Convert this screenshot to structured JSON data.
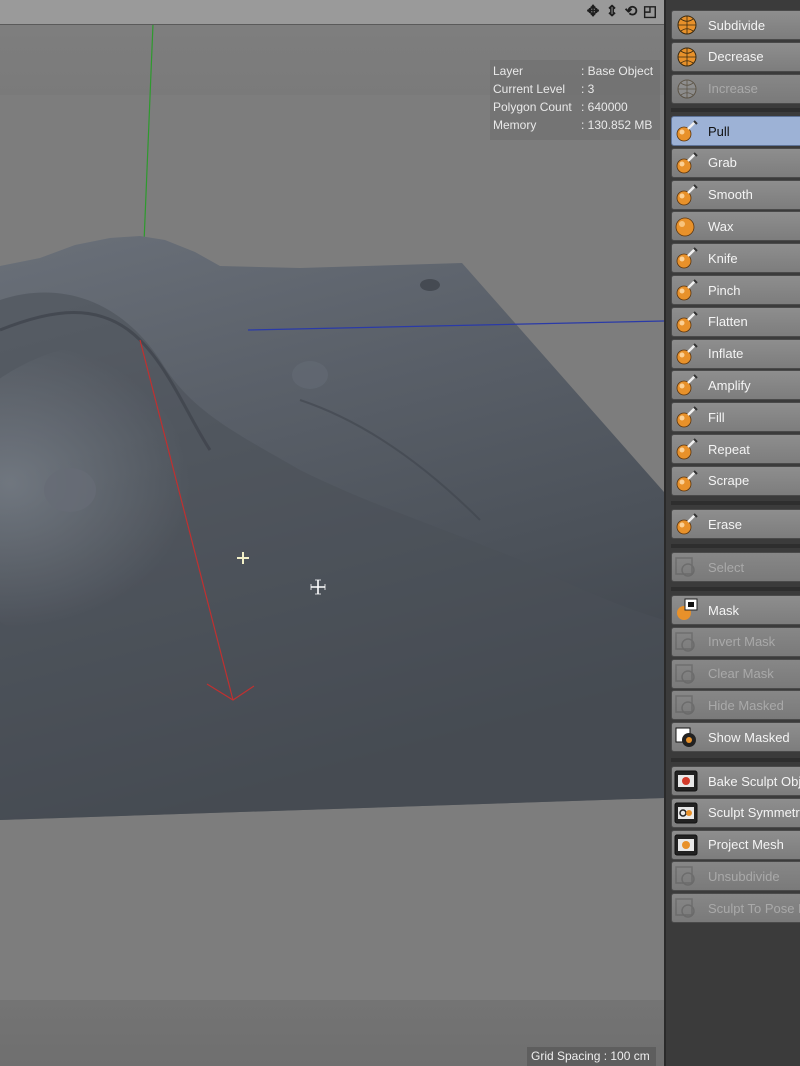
{
  "viewport": {
    "nav_icons": [
      "move-view-icon",
      "dolly-view-icon",
      "rotate-view-icon",
      "maximize-view-icon"
    ],
    "nav_glyphs": [
      "✥",
      "⇕",
      "⟲",
      "◰"
    ],
    "hud": [
      {
        "key": "Layer",
        "value": ": Base Object"
      },
      {
        "key": "Current Level",
        "value": ": 3"
      },
      {
        "key": "Polygon Count",
        "value": ": 640000"
      },
      {
        "key": "Memory",
        "value": ": 130.852 MB"
      }
    ],
    "grid_spacing": "Grid Spacing : 100 cm",
    "colors": {
      "x_axis": "#c03030",
      "y_axis": "#2e9a2e",
      "z_axis": "#2a3aa8",
      "mesh": "#4f555e"
    }
  },
  "palette": {
    "groups": [
      [
        {
          "label": "Subdivide",
          "icon": "subdivide-globe-icon",
          "state": "normal"
        },
        {
          "label": "Decrease",
          "icon": "decrease-globe-icon",
          "state": "normal"
        },
        {
          "label": "Increase",
          "icon": "increase-globe-icon",
          "state": "disabled"
        }
      ],
      [
        {
          "label": "Pull",
          "icon": "pull-brush-icon",
          "state": "active"
        },
        {
          "label": "Grab",
          "icon": "grab-brush-icon",
          "state": "normal"
        },
        {
          "label": "Smooth",
          "icon": "smooth-brush-icon",
          "state": "normal"
        },
        {
          "label": "Wax",
          "icon": "wax-brush-icon",
          "state": "normal"
        },
        {
          "label": "Knife",
          "icon": "knife-brush-icon",
          "state": "normal"
        },
        {
          "label": "Pinch",
          "icon": "pinch-brush-icon",
          "state": "normal"
        },
        {
          "label": "Flatten",
          "icon": "flatten-brush-icon",
          "state": "normal"
        },
        {
          "label": "Inflate",
          "icon": "inflate-brush-icon",
          "state": "normal"
        },
        {
          "label": "Amplify",
          "icon": "amplify-brush-icon",
          "state": "normal"
        },
        {
          "label": "Fill",
          "icon": "fill-brush-icon",
          "state": "normal"
        },
        {
          "label": "Repeat",
          "icon": "repeat-brush-icon",
          "state": "normal"
        },
        {
          "label": "Scrape",
          "icon": "scrape-brush-icon",
          "state": "normal"
        }
      ],
      [
        {
          "label": "Erase",
          "icon": "erase-brush-icon",
          "state": "normal"
        }
      ],
      [
        {
          "label": "Select",
          "icon": "select-icon",
          "state": "disabled"
        }
      ],
      [
        {
          "label": "Mask",
          "icon": "mask-brush-icon",
          "state": "normal"
        },
        {
          "label": "Invert Mask",
          "icon": "invert-mask-icon",
          "state": "disabled"
        },
        {
          "label": "Clear Mask",
          "icon": "clear-mask-icon",
          "state": "disabled"
        },
        {
          "label": "Hide Masked",
          "icon": "hide-masked-icon",
          "state": "disabled"
        },
        {
          "label": "Show Masked",
          "icon": "show-masked-icon",
          "state": "normal"
        }
      ],
      [
        {
          "label": "Bake Sculpt Obje",
          "icon": "bake-sculpt-icon",
          "state": "normal"
        },
        {
          "label": "Sculpt Symmetry",
          "icon": "sculpt-symmetry-icon",
          "state": "normal"
        },
        {
          "label": "Project Mesh",
          "icon": "project-mesh-icon",
          "state": "normal"
        },
        {
          "label": "Unsubdivide",
          "icon": "unsubdivide-icon",
          "state": "disabled"
        },
        {
          "label": "Sculpt To Pose M",
          "icon": "sculpt-to-pose-icon",
          "state": "disabled"
        }
      ]
    ],
    "colors": {
      "active": "#9db2d6",
      "brush_orange": "#e8912a"
    }
  }
}
